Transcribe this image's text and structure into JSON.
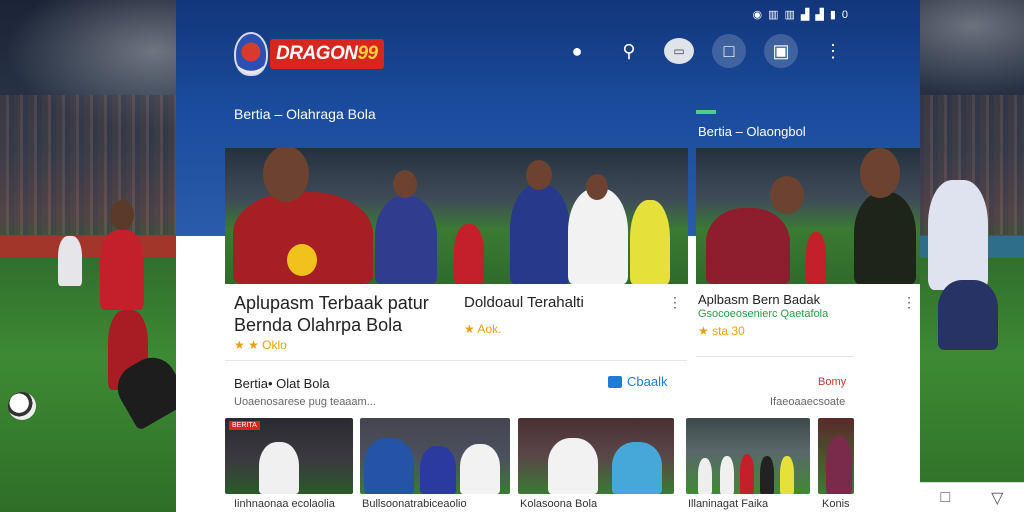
{
  "app": {
    "brand": "DRAGON",
    "brand_suffix": "99"
  },
  "status_bar": {
    "icons": [
      "eye",
      "sim",
      "sim",
      "signal",
      "signal",
      "battery"
    ],
    "battery_text": "0"
  },
  "header": {
    "section_left": "Bertia – Olahraga Bola",
    "section_right": "Bertia – Olaongbol"
  },
  "cards": {
    "main_title_line1": "Aplupasm Terbaak patur",
    "main_title_line2": "Bernda Olahrpa Bola",
    "main_meta": "★ ★ Oklo",
    "second_title": "Doldoaul Terahalti",
    "second_meta": "★ Aok.",
    "right_title": "Aplbasm Bern Badak",
    "right_sub": "Gsocoeosenierc Qaetafola",
    "right_meta": "★ sta 30"
  },
  "news": {
    "section_title": "Bertia• Olat Bola",
    "section_sub": "Uoaenosarese pug teaaam...",
    "cta": "Cbaalk",
    "right_label": "Bomy",
    "right_sub": "Ifaeoaaecsoate"
  },
  "thumbnails": [
    {
      "caption": "Iinhnaonaa ecolaolia",
      "tag": "BERITA"
    },
    {
      "caption": "Bullsoonatrabiceaolio",
      "tag": ""
    },
    {
      "caption": "Kolasoona Bola",
      "tag": ""
    },
    {
      "caption": "Illaninagat Faika",
      "tag": ""
    },
    {
      "caption": "Konis",
      "tag": ""
    }
  ],
  "colors": {
    "header_blue": "#1a4b9c",
    "brand_red": "#d7261e",
    "star": "#e8a013",
    "cta_blue": "#1f7bd8"
  }
}
